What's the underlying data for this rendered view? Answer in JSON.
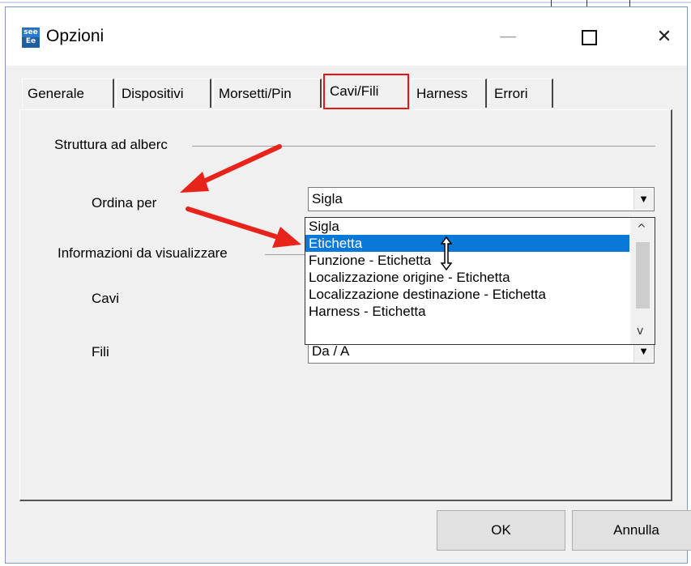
{
  "window": {
    "title": "Opzioni",
    "app_icon_top": "see",
    "app_icon_bottom": "Ee",
    "minimize_glyph": "—",
    "close_glyph": "✕"
  },
  "tabs": [
    {
      "label": "Generale",
      "selected": false
    },
    {
      "label": "Dispositivi",
      "selected": false
    },
    {
      "label": "Morsetti/Pin",
      "selected": false
    },
    {
      "label": "Cavi/Fili",
      "selected": true
    },
    {
      "label": "Harness",
      "selected": false
    },
    {
      "label": "Errori",
      "selected": false
    }
  ],
  "panel": {
    "tree_group_label": "Struttura ad alberc",
    "sort_label": "Ordina per",
    "sort_value": "Sigla",
    "info_group_label": "Informazioni da visualizzare",
    "cables_label": "Cavi",
    "wires_label": "Fili",
    "wires_value": "Da / A"
  },
  "dropdown": {
    "items": [
      {
        "label": "Sigla",
        "highlighted": false
      },
      {
        "label": "Etichetta",
        "highlighted": true
      },
      {
        "label": "Funzione - Etichetta",
        "highlighted": false
      },
      {
        "label": "Localizzazione origine - Etichetta",
        "highlighted": false
      },
      {
        "label": "Localizzazione destinazione - Etichetta",
        "highlighted": false
      },
      {
        "label": "Harness - Etichetta",
        "highlighted": false
      }
    ],
    "scroll_up_glyph": "^",
    "scroll_down_glyph": "v"
  },
  "buttons": {
    "ok": "OK",
    "cancel": "Annulla"
  },
  "colors": {
    "highlight": "#0a78d7",
    "annotation_red": "#e8231b",
    "tab_outline": "#e11111"
  }
}
